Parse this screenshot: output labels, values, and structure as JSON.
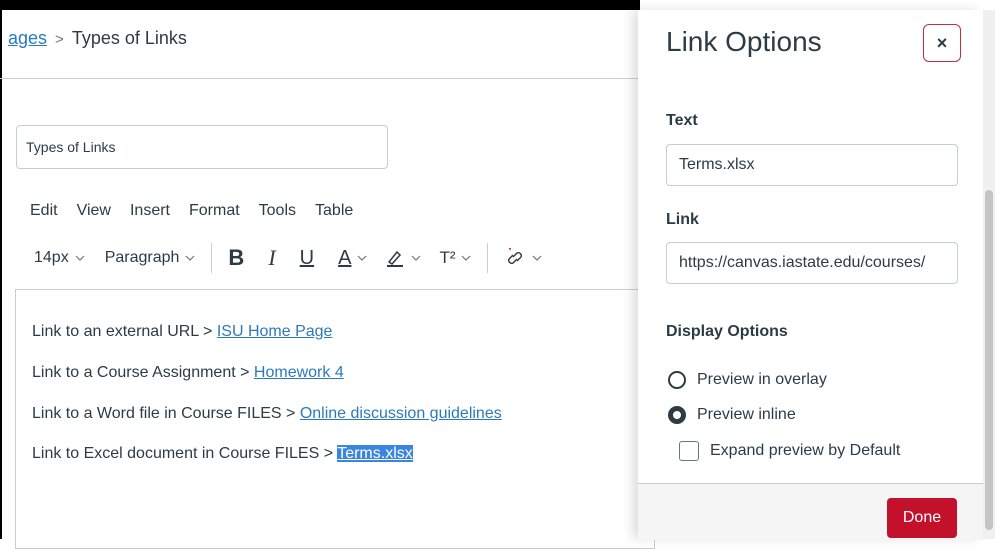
{
  "breadcrumb": {
    "parent": "ages",
    "separator": ">",
    "current": "Types of Links"
  },
  "title_field": {
    "value": "Types of Links"
  },
  "menubar": [
    "Edit",
    "View",
    "Insert",
    "Format",
    "Tools",
    "Table"
  ],
  "toolbar": {
    "font_size": "14px",
    "block_format": "Paragraph",
    "bold": "B",
    "italic": "I",
    "underline": "U",
    "text_color": "A",
    "superscript": "T²"
  },
  "editor": {
    "lines": [
      {
        "prefix": "Link to an external URL > ",
        "link": "ISU Home Page"
      },
      {
        "prefix": "Link to a Course Assignment > ",
        "link": " Homework 4"
      },
      {
        "prefix": "Link to a Word  file in Course FILES > ",
        "link": "Online discussion guidelines"
      },
      {
        "prefix": "Link to Excel document in Course FILES > ",
        "link": "Terms.xlsx"
      }
    ]
  },
  "panel": {
    "title": "Link Options",
    "close": "×",
    "text_label": "Text",
    "text_value": "Terms.xlsx",
    "link_label": "Link",
    "link_value": "https://canvas.iastate.edu/courses/",
    "display_label": "Display Options",
    "option_overlay": "Preview in overlay",
    "option_inline": "Preview inline",
    "option_expand": "Expand preview by Default",
    "done": "Done"
  },
  "colors": {
    "accent": "#c4112b",
    "link": "#2b7abc",
    "selection": "#3a85e0"
  }
}
